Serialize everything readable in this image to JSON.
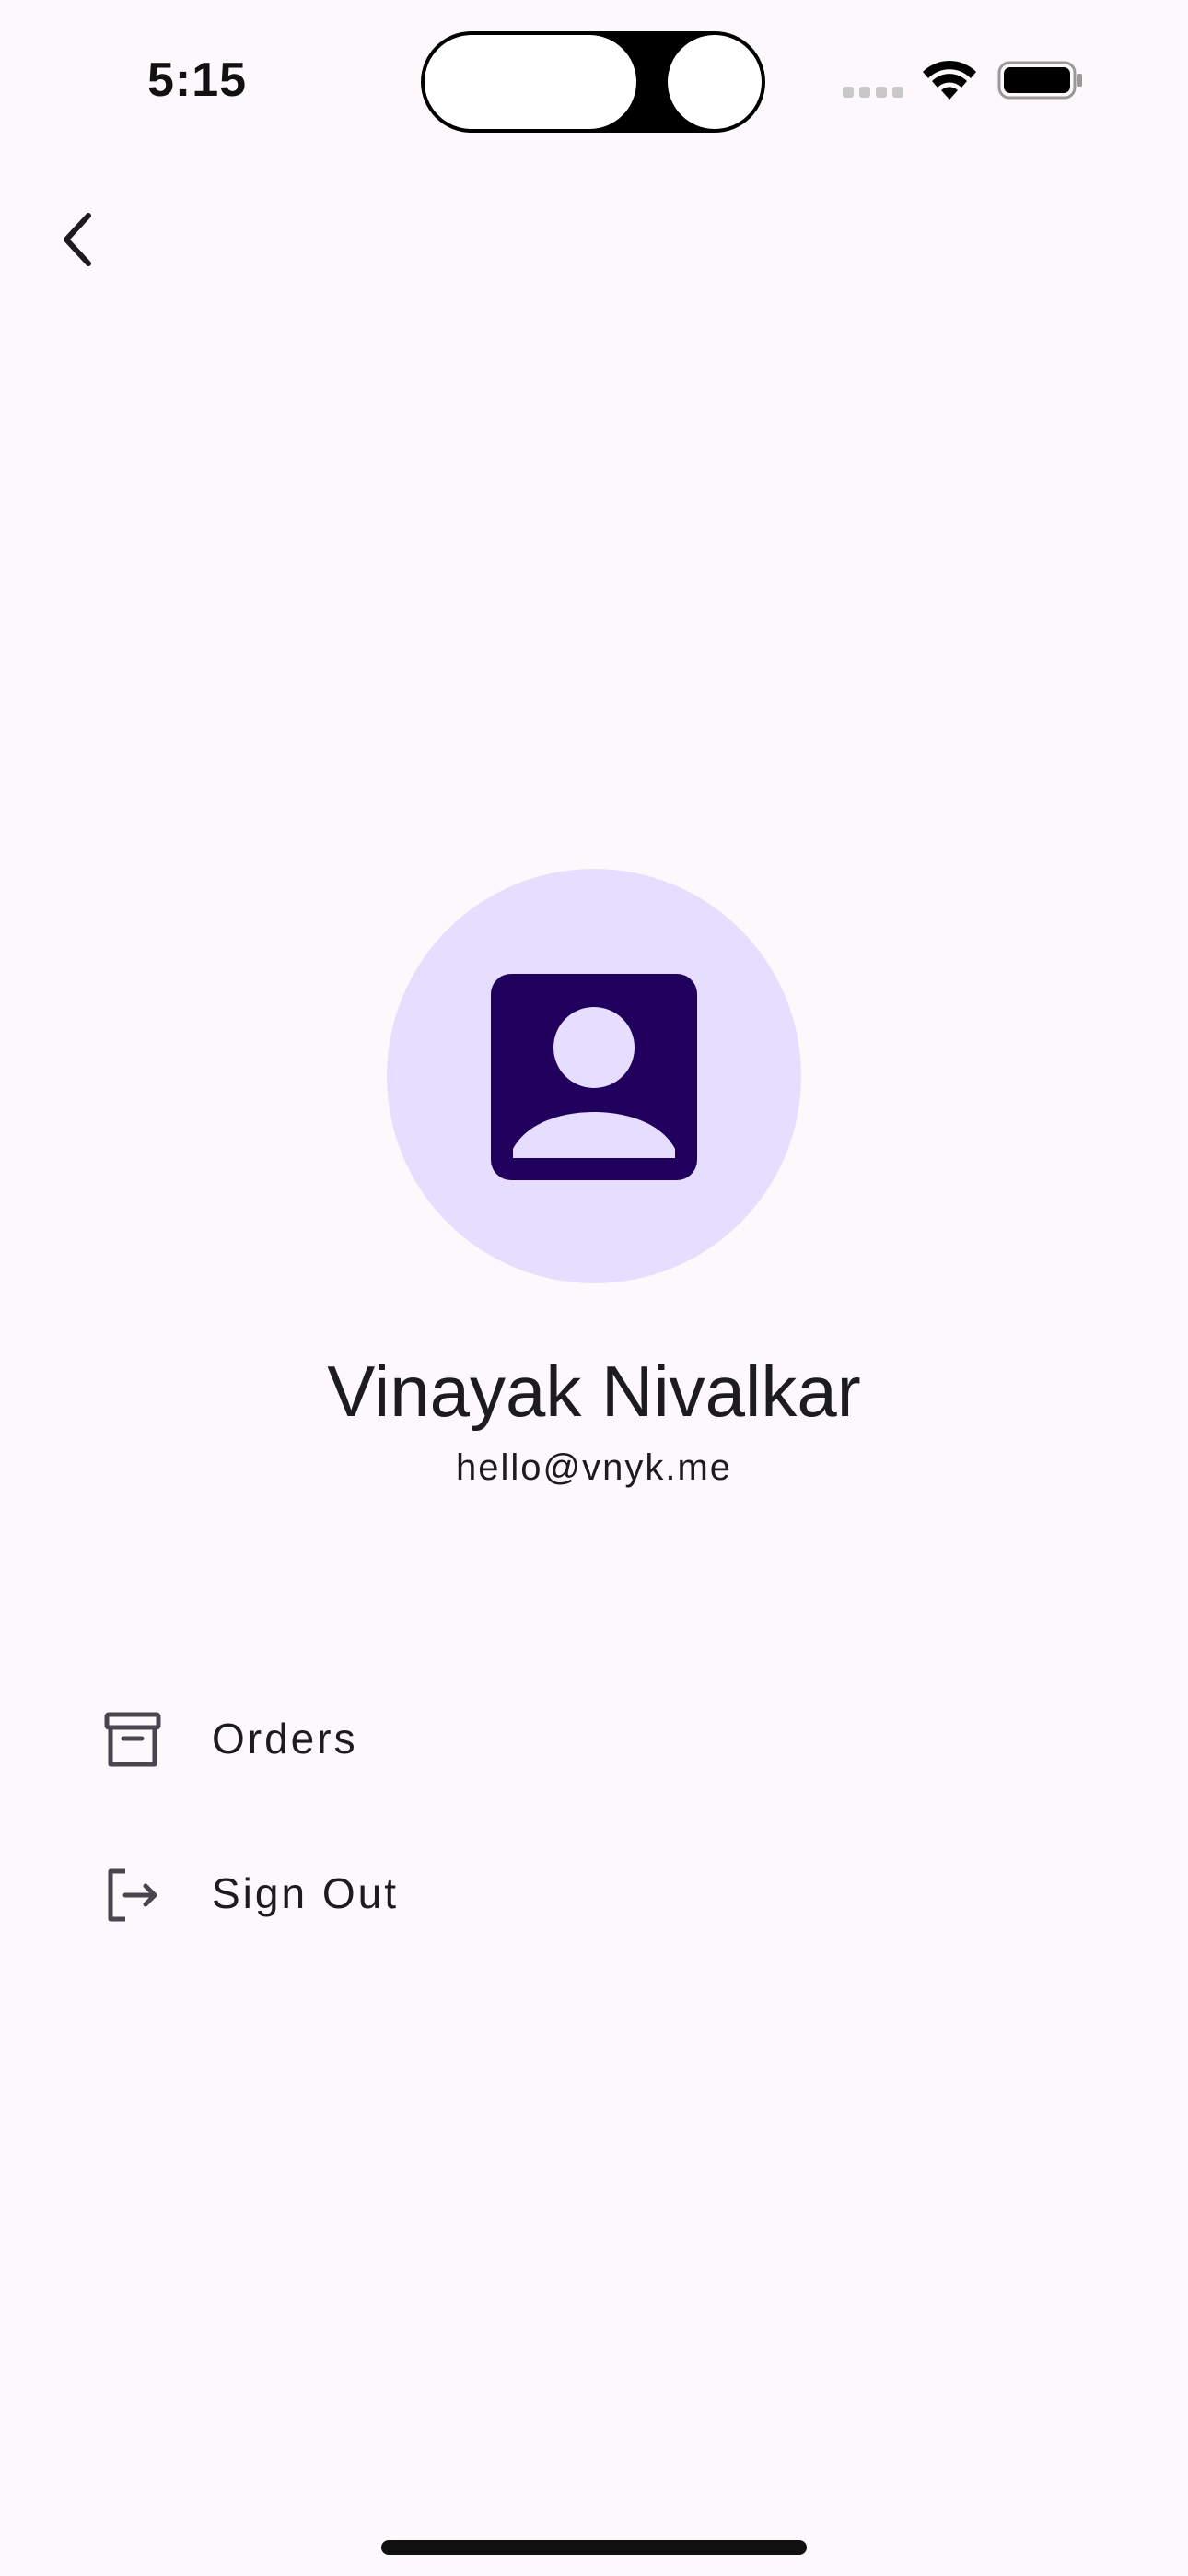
{
  "status_bar": {
    "time": "5:15",
    "signal_icon": "cellular-signal-icon",
    "wifi_icon": "wifi-icon",
    "battery_icon": "battery-full-icon"
  },
  "header": {
    "back_icon": "chevron-left-icon"
  },
  "profile": {
    "avatar_icon": "account-box-icon",
    "name": "Vinayak Nivalkar",
    "email": "hello@vnyk.me",
    "avatar_bg_color": "#e7deff",
    "avatar_icon_color": "#21005d"
  },
  "menu": {
    "items": [
      {
        "icon": "archive-box-icon",
        "label": "Orders"
      },
      {
        "icon": "logout-icon",
        "label": "Sign Out"
      }
    ]
  },
  "colors": {
    "background": "#fdf8fc",
    "text": "#1c1b1f"
  }
}
